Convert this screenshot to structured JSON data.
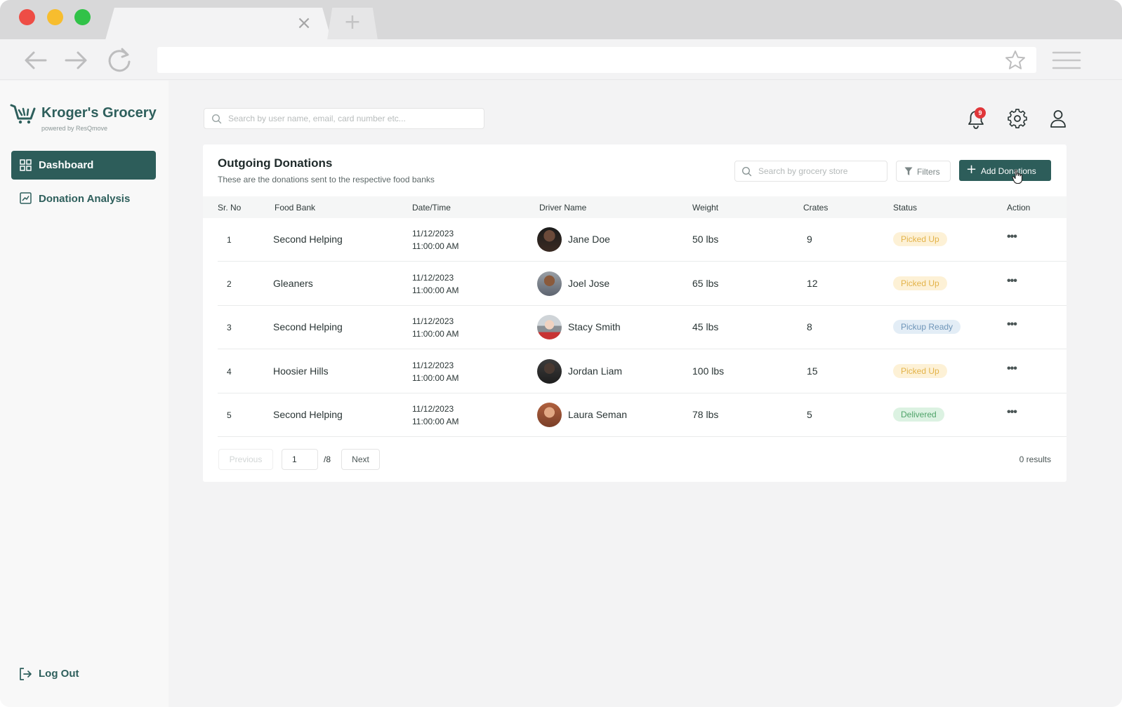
{
  "app": {
    "brand_name": "Kroger's Grocery",
    "brand_sub": "powered by ResQmove",
    "accent_color": "#2d5d5a",
    "notification_count": "9"
  },
  "sidebar": {
    "items": [
      {
        "label": "Dashboard",
        "icon": "grid-icon",
        "active": true
      },
      {
        "label": "Donation Analysis",
        "icon": "chart-icon",
        "active": false
      }
    ],
    "logout_label": "Log Out"
  },
  "header": {
    "search_placeholder": "Search by user name, email, card number etc..."
  },
  "card": {
    "title": "Outgoing Donations",
    "subtitle": "These are the donations sent to the respective food banks",
    "grocery_search_placeholder": "Search by grocery store",
    "filters_label": "Filters",
    "add_label": "Add Donations"
  },
  "table": {
    "columns": [
      "Sr. No",
      "Food Bank",
      "Date/Time",
      "Driver Name",
      "Weight",
      "Crates",
      "Status",
      "Action"
    ],
    "rows": [
      {
        "sr": "1",
        "food_bank": "Second Helping",
        "date": "11/12/2023",
        "time": "11:00:00 AM",
        "driver": "Jane Doe",
        "weight": "50 lbs",
        "crates": "9",
        "status": "Picked Up",
        "status_kind": "picked"
      },
      {
        "sr": "2",
        "food_bank": "Gleaners",
        "date": "11/12/2023",
        "time": "11:00:00 AM",
        "driver": "Joel Jose",
        "weight": "65 lbs",
        "crates": "12",
        "status": "Picked Up",
        "status_kind": "picked"
      },
      {
        "sr": "3",
        "food_bank": "Second Helping",
        "date": "11/12/2023",
        "time": "11:00:00 AM",
        "driver": "Stacy Smith",
        "weight": "45 lbs",
        "crates": "8",
        "status": "Pickup Ready",
        "status_kind": "ready"
      },
      {
        "sr": "4",
        "food_bank": "Hoosier Hills",
        "date": "11/12/2023",
        "time": "11:00:00 AM",
        "driver": "Jordan Liam",
        "weight": "100 lbs",
        "crates": "15",
        "status": "Picked Up",
        "status_kind": "picked"
      },
      {
        "sr": "5",
        "food_bank": "Second Helping",
        "date": "11/12/2023",
        "time": "11:00:00 AM",
        "driver": "Laura Seman",
        "weight": "78 lbs",
        "crates": "5",
        "status": "Delivered",
        "status_kind": "delivered"
      }
    ],
    "action_glyph": "•••"
  },
  "pagination": {
    "prev_label": "Previous",
    "page_value": "1",
    "total_label": "/8",
    "next_label": "Next",
    "results_label": "0 results"
  },
  "status_colors": {
    "picked": {
      "bg": "#fdf1d6",
      "fg": "#e3b34a"
    },
    "ready": {
      "bg": "#e3edf6",
      "fg": "#6f95b8"
    },
    "delivered": {
      "bg": "#dcf2e2",
      "fg": "#4fa369"
    }
  }
}
